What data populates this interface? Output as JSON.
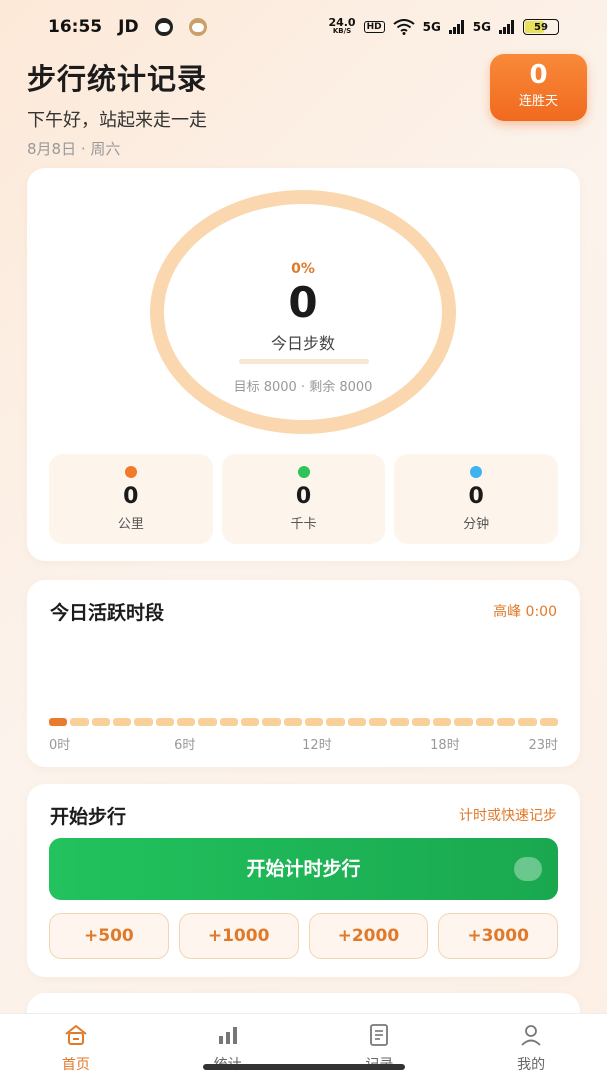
{
  "status": {
    "time": "16:55",
    "carrier": "JD",
    "speed_value": "24.0",
    "speed_unit": "KB/S",
    "hd": "HD",
    "net1": "5G",
    "net2": "5G",
    "battery": "59"
  },
  "header": {
    "title": "步行统计记录",
    "greeting": "下午好，站起来走一走",
    "date": "8月8日 · 周六",
    "streak_value": "0",
    "streak_label": "连胜天"
  },
  "today": {
    "percent_text": "0%",
    "progress": 0,
    "steps": "0",
    "steps_label": "今日步数",
    "goal_text": "目标 8000 · 剩余 8000"
  },
  "stats": [
    {
      "value": "0",
      "label": "公里",
      "color": "#f07a2a"
    },
    {
      "value": "0",
      "label": "千卡",
      "color": "#2fc45a"
    },
    {
      "value": "0",
      "label": "分钟",
      "color": "#3db3f0"
    }
  ],
  "activity": {
    "title": "今日活跃时段",
    "peak": "高峰 0:00",
    "hour_values": [
      1,
      0,
      0,
      0,
      0,
      0,
      0,
      0,
      0,
      0,
      0,
      0,
      0,
      0,
      0,
      0,
      0,
      0,
      0,
      0,
      0,
      0,
      0,
      0
    ],
    "axis_labels": [
      "0时",
      "6时",
      "12时",
      "18时",
      "23时"
    ]
  },
  "walk": {
    "title": "开始步行",
    "hint": "计时或快速记步",
    "start_label": "开始计时步行",
    "quick": [
      "+500",
      "+1000",
      "+2000",
      "+3000"
    ]
  },
  "tabs": [
    {
      "label": "首页",
      "icon": "home-icon",
      "active": true
    },
    {
      "label": "统计",
      "icon": "bar-chart-icon",
      "active": false
    },
    {
      "label": "记录",
      "icon": "document-icon",
      "active": false
    },
    {
      "label": "我的",
      "icon": "user-icon",
      "active": false
    }
  ],
  "colors": {
    "accent": "#e07a2a",
    "primary_green": "#22c25e",
    "ring": "#fbd7b0"
  }
}
